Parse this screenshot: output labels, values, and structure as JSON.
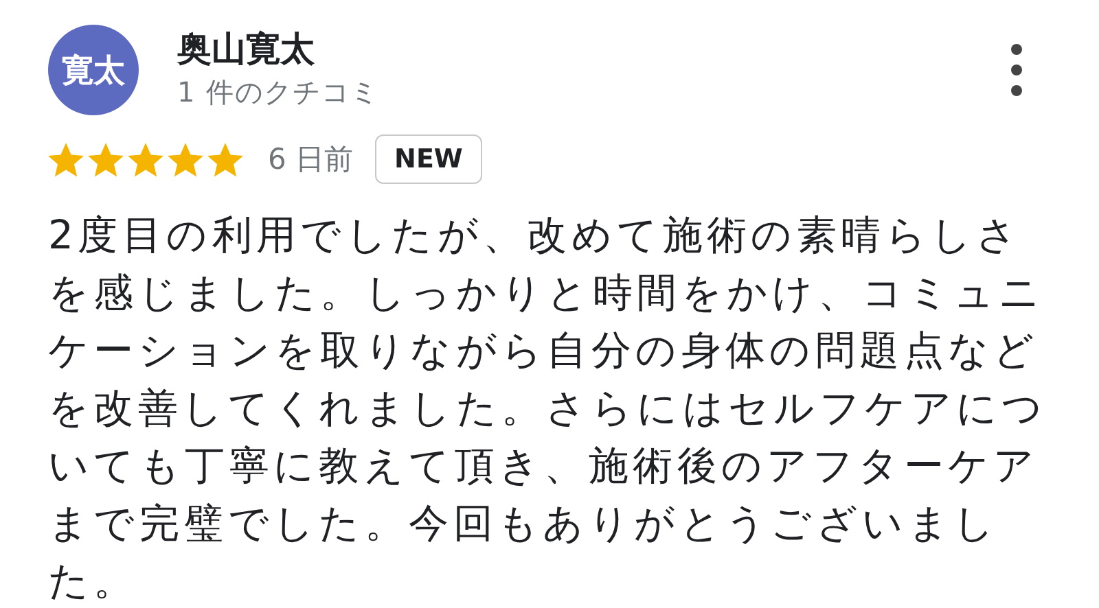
{
  "review": {
    "avatar": {
      "initials": "寛太",
      "color": "#5c6bc0"
    },
    "author": "奥山寛太",
    "review_count": "1 件のクチコミ",
    "stars": 5,
    "date": "6 日前",
    "badge": "NEW",
    "text": "2度目の利用でしたが、改めて施術の素晴らしさを感じました。しっかりと時間をかけ、コミュニケーションを取りながら自分の身体の問題点などを改善してくれました。さらにはセルフケアについても丁寧に教えて頂き、施術後のアフターケアまで完璧でした。今回もありがとうございました。"
  }
}
